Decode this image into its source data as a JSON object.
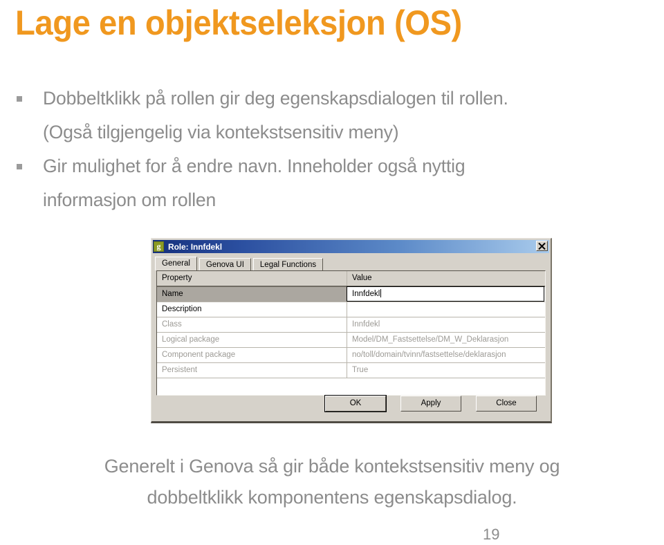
{
  "slide": {
    "title": "Lage en objektseleksjon (OS)",
    "title_color": "#F0981F",
    "body_text_color": "#8C8C8C",
    "page_number": "19"
  },
  "bullets": [
    {
      "marker": "square-bullet",
      "line1": "Dobbeltklikk på rollen gir deg egenskapsdialogen til rollen.",
      "line2": "(Også tilgjengelig via kontekstsensitiv meny)"
    },
    {
      "marker": "square-bullet",
      "line1": "Gir mulighet for å endre navn. Inneholder også nyttig",
      "line2": "informasjon om rollen"
    }
  ],
  "dialog": {
    "app_icon_letter": "g",
    "title": "Role: Innfdekl",
    "close_icon": "close-x-icon",
    "titlebar_gradient_start": "#16307C",
    "titlebar_gradient_end": "#A9CBEC",
    "face_color": "#D6D2CA",
    "tabs": [
      {
        "label": "General",
        "active": true
      },
      {
        "label": "Genova UI",
        "active": false
      },
      {
        "label": "Legal Functions",
        "active": false
      }
    ],
    "grid": {
      "columns": [
        "Property",
        "Value"
      ],
      "rows": [
        {
          "property": "Name",
          "value": "Innfdekl",
          "state": "selected"
        },
        {
          "property": "Description",
          "value": "",
          "state": "editable"
        },
        {
          "property": "Class",
          "value": "Innfdekl",
          "state": "disabled"
        },
        {
          "property": "Logical package",
          "value": "Model/DM_Fastsettelse/DM_W_Deklarasjon",
          "state": "disabled"
        },
        {
          "property": "Component package",
          "value": "no/toll/domain/tvinn/fastsettelse/deklarasjon",
          "state": "disabled"
        },
        {
          "property": "Persistent",
          "value": "True",
          "state": "disabled"
        }
      ]
    },
    "buttons": [
      {
        "label": "OK",
        "default": true
      },
      {
        "label": "Apply",
        "default": false
      },
      {
        "label": "Close",
        "default": false
      }
    ]
  },
  "caption": {
    "line1": "Generelt i Genova så gir både kontekstsensitiv meny og",
    "line2": "dobbeltklikk komponentens egenskapsdialog."
  }
}
